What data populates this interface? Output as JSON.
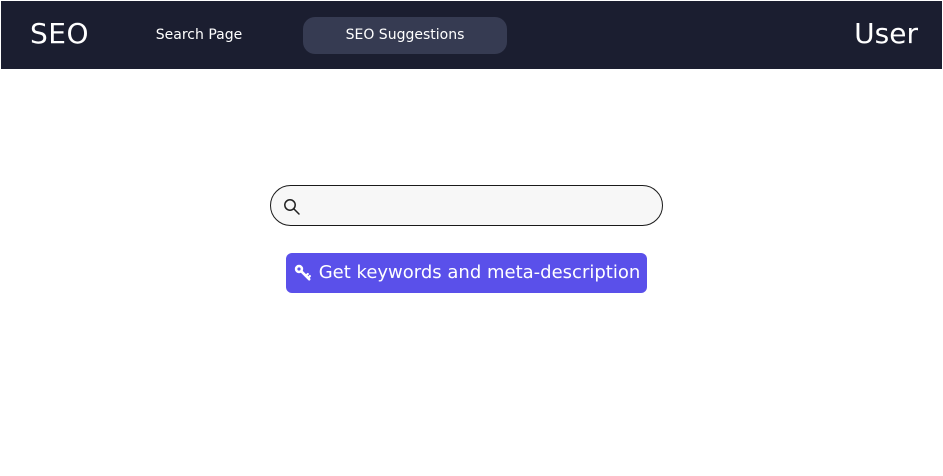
{
  "app": {
    "brand": "SEO",
    "nav": {
      "search_page": "Search Page",
      "seo_suggestions": "SEO Suggestions"
    },
    "user_label": "User",
    "colors": {
      "header_bg": "#1b1e30",
      "active_nav_bg": "#363b52",
      "action_button_bg": "#5a50ea",
      "search_bg": "#f7f7f7"
    }
  },
  "search": {
    "placeholder": "",
    "value": "",
    "icon": "search-icon"
  },
  "action": {
    "label": "Get keywords and meta-description",
    "icon": "key-icon"
  }
}
